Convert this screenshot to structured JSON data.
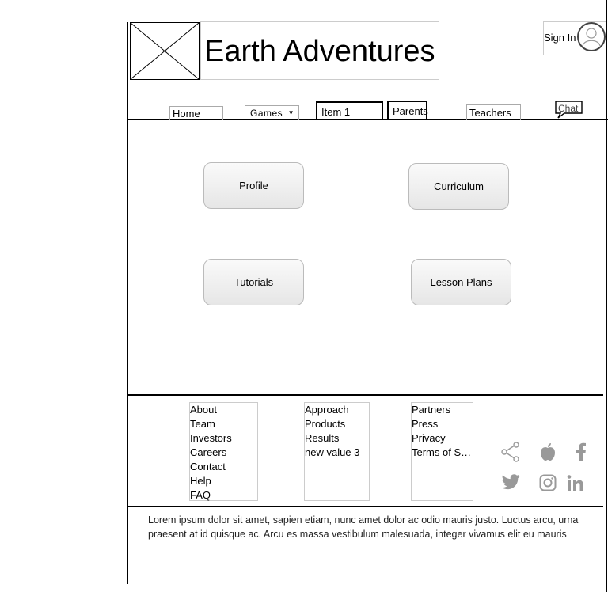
{
  "header": {
    "title": "Earth Adventures",
    "sign_in_label": "Sign In"
  },
  "nav": {
    "home": "Home",
    "games": "Games",
    "item1": "Item 1",
    "parents": "Parents",
    "teachers": "Teachers",
    "chat": "Chat"
  },
  "cards": {
    "profile": "Profile",
    "curriculum": "Curriculum",
    "tutorials": "Tutorials",
    "lesson_plans": "Lesson Plans"
  },
  "footer": {
    "col1": [
      "About",
      "Team",
      "Investors",
      "Careers",
      "Contact",
      "Help",
      "FAQ"
    ],
    "col2": [
      "Approach",
      "Products",
      "Results",
      "new value 3"
    ],
    "col3": [
      "Partners",
      "Press",
      "Privacy",
      "Terms of Service"
    ]
  },
  "social_icons": [
    "share-icon",
    "apple-icon",
    "facebook-icon",
    "twitter-icon",
    "instagram-icon",
    "linkedin-icon"
  ],
  "body_text": "Lorem ipsum dolor sit amet, sapien etiam, nunc amet dolor ac odio mauris justo. Luctus arcu, urna praesent at id quisque ac. Arcu es massa vestibulum malesuada, integer vivamus elit eu mauris"
}
